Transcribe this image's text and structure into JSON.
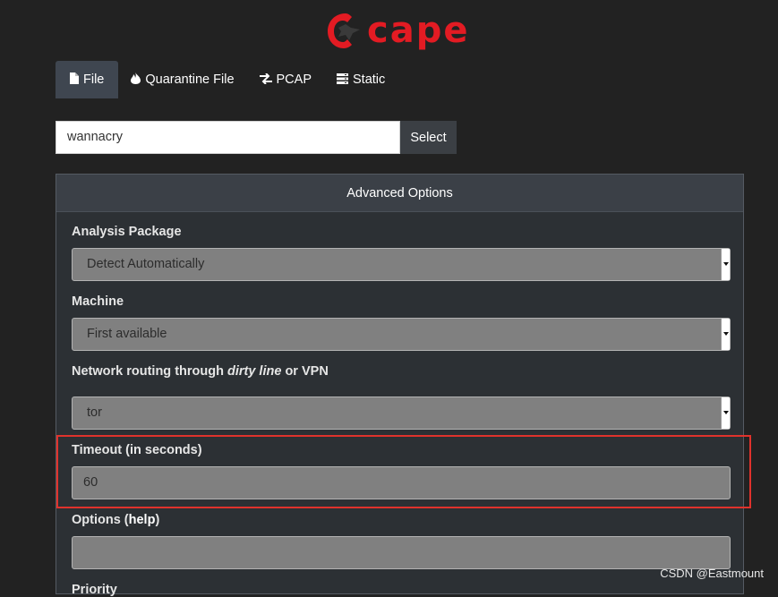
{
  "brand": {
    "name": "cape",
    "color": "#e31b23"
  },
  "tabs": [
    {
      "label": "File",
      "icon": "file-icon",
      "active": true
    },
    {
      "label": "Quarantine File",
      "icon": "fire-icon",
      "active": false
    },
    {
      "label": "PCAP",
      "icon": "exchange-icon",
      "active": false
    },
    {
      "label": "Static",
      "icon": "server-icon",
      "active": false
    }
  ],
  "file_picker": {
    "value": "wannacry",
    "button_label": "Select"
  },
  "panel": {
    "title": "Advanced Options",
    "analysis_package": {
      "label": "Analysis Package",
      "selected": "Detect Automatically"
    },
    "machine": {
      "label": "Machine",
      "selected": "First available"
    },
    "routing": {
      "label_prefix": "Network routing through ",
      "label_em": "dirty line",
      "label_suffix": " or VPN",
      "selected": "tor"
    },
    "timeout": {
      "label": "Timeout (in seconds)",
      "value": "60"
    },
    "options": {
      "label_prefix": "Options (",
      "label_help": "help",
      "label_suffix": ")",
      "value": ""
    },
    "priority": {
      "label": "Priority"
    }
  },
  "annotation": {
    "highlight_color": "#e0322c"
  },
  "watermark": "CSDN @Eastmount"
}
